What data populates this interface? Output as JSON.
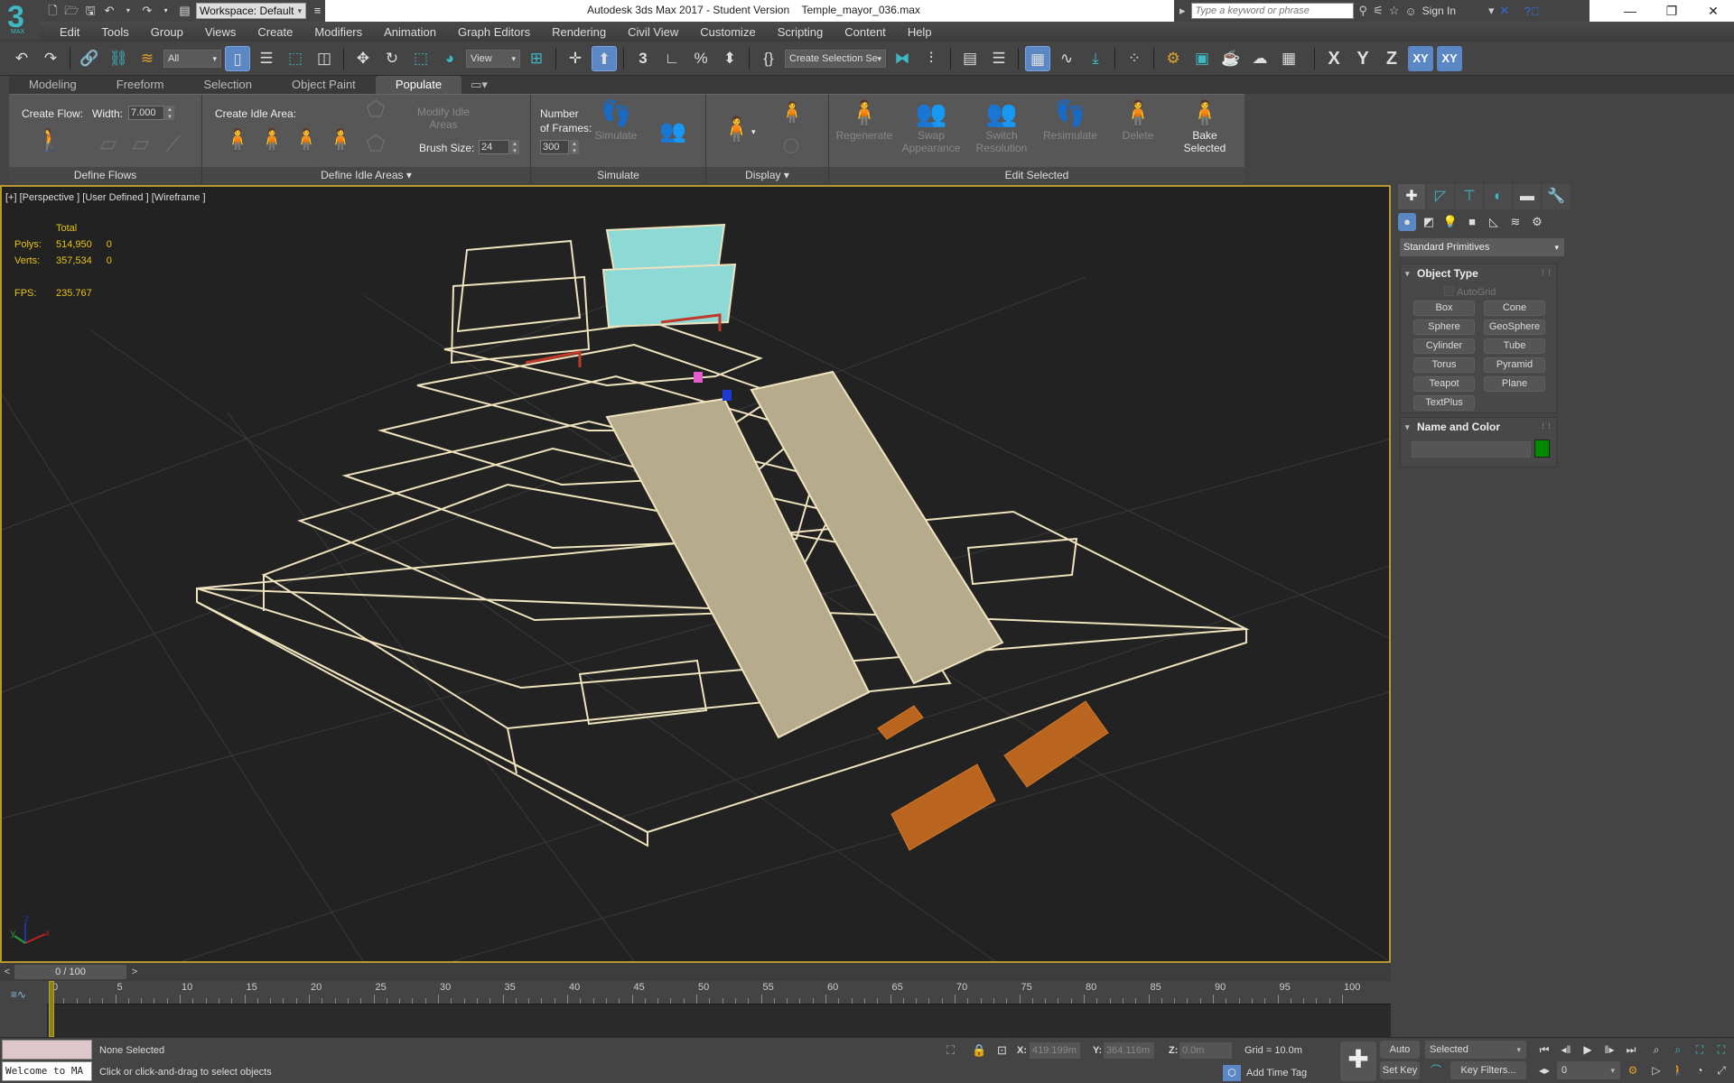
{
  "app": {
    "title": "Autodesk 3ds Max 2017 - Student Version",
    "file": "Temple_mayor_036.max",
    "logo_number": "3",
    "logo_sub": "MAX"
  },
  "quick_access": {
    "workspace": "Workspace: Default",
    "icons": [
      "new-file-icon",
      "open-file-icon",
      "save-icon",
      "undo-icon",
      "redo-icon",
      "project-folder-icon"
    ]
  },
  "infocenter": {
    "search_placeholder": "Type a keyword or phrase",
    "sign_in": "Sign In",
    "icons": [
      "binoculars-icon",
      "satellite-icon",
      "star-icon",
      "user-icon",
      "exchange-icon",
      "help-icon"
    ]
  },
  "window_controls": {
    "minimize": "—",
    "restore": "❐",
    "close": "✕"
  },
  "menu": [
    "Edit",
    "Tools",
    "Group",
    "Views",
    "Create",
    "Modifiers",
    "Animation",
    "Graph Editors",
    "Rendering",
    "Civil View",
    "Customize",
    "Scripting",
    "Content",
    "Help"
  ],
  "toolbar": {
    "selection_filter": "All",
    "ref_coord": "View",
    "named_selection": "Create Selection Se",
    "axes": [
      "X",
      "Y",
      "Z",
      "XY",
      "XY"
    ]
  },
  "ribbon": {
    "tabs": [
      "Modeling",
      "Freeform",
      "Selection",
      "Object Paint",
      "Populate"
    ],
    "active_tab": "Populate",
    "panels": {
      "define_flows": {
        "title": "Define Flows",
        "create_flow": "Create Flow:",
        "width_label": "Width:",
        "width_value": "7.000"
      },
      "define_idle": {
        "title": "Define Idle Areas",
        "create_idle": "Create Idle Area:",
        "modify": "Modify Idle Areas",
        "brush_label": "Brush Size:",
        "brush_value": "24"
      },
      "simulate": {
        "title": "Simulate",
        "frames_label_1": "Number",
        "frames_label_2": "of Frames:",
        "frames_value": "300",
        "simulate_btn": "Simulate"
      },
      "display": {
        "title": "Display"
      },
      "edit_selected": {
        "title": "Edit Selected",
        "buttons": [
          "Regenerate",
          "Swap Appearance",
          "Switch Resolution",
          "Resimulate",
          "Delete",
          "Bake Selected"
        ]
      }
    }
  },
  "viewport": {
    "label": "[+] [Perspective ] [User Defined ] [Wireframe ]",
    "stats": {
      "header": "Total",
      "polys_label": "Polys:",
      "polys_total": "514,950",
      "polys_sel": "0",
      "verts_label": "Verts:",
      "verts_total": "357,534",
      "verts_sel": "0",
      "fps_label": "FPS:",
      "fps": "235.767"
    },
    "gizmo": {
      "x": "x",
      "y": "y",
      "z": "z"
    }
  },
  "command_panel": {
    "category": "Standard Primitives",
    "object_type_title": "Object Type",
    "autogrid": "AutoGrid",
    "buttons": [
      "Box",
      "Cone",
      "Sphere",
      "GeoSphere",
      "Cylinder",
      "Tube",
      "Torus",
      "Pyramid",
      "Teapot",
      "Plane",
      "TextPlus"
    ],
    "name_color_title": "Name and Color",
    "name_value": "",
    "color": "#008a00"
  },
  "time_slider": {
    "prev": "<",
    "next": ">",
    "position": "0 / 100",
    "current_frame": 0,
    "total_frames": 100
  },
  "trackbar": {
    "ticks": [
      0,
      5,
      10,
      15,
      20,
      25,
      30,
      35,
      40,
      45,
      50,
      55,
      60,
      65,
      70,
      75,
      80,
      85,
      90,
      95,
      100
    ]
  },
  "status": {
    "maxscript_line": "",
    "maxscript_output": "Welcome to MA",
    "selection": "None Selected",
    "prompt": "Click or click-and-drag to select objects",
    "x_label": "X:",
    "x": "419.199m",
    "y_label": "Y:",
    "y": "364.116m",
    "z_label": "Z:",
    "z": "0.0m",
    "grid": "Grid = 10.0m",
    "time_tag": "Add Time Tag",
    "auto_key": "Auto Key",
    "set_key": "Set Key",
    "key_mode": "Selected",
    "key_filters": "Key Filters...",
    "frame_value": "0"
  }
}
